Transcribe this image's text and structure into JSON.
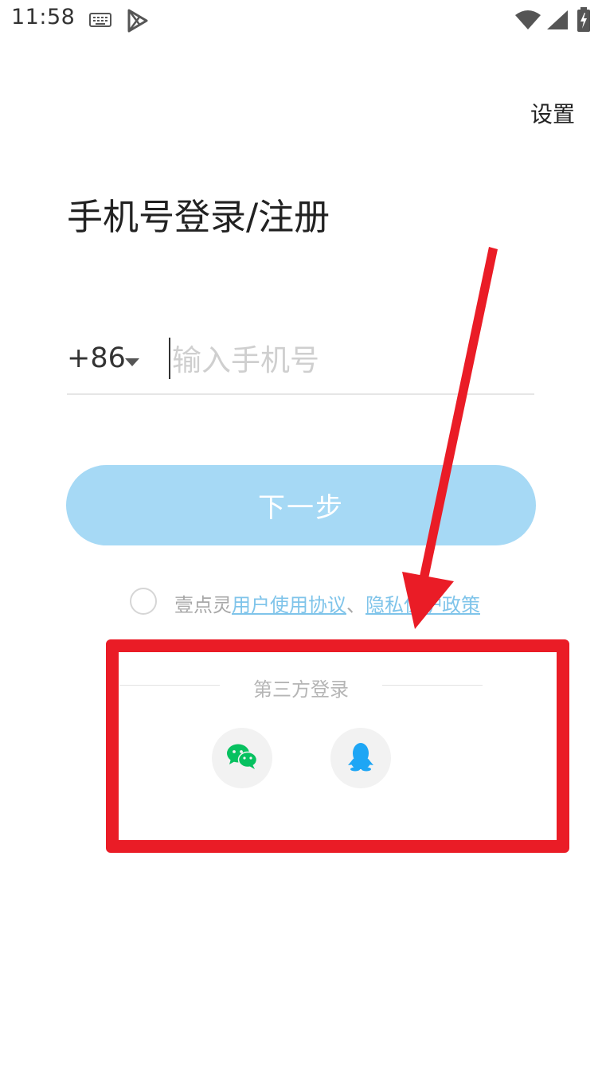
{
  "status_bar": {
    "time": "11:58",
    "icons": [
      "keyboard-icon",
      "play-store-icon",
      "wifi-icon",
      "signal-icon",
      "battery-charging-icon"
    ]
  },
  "header": {
    "settings_label": "设置"
  },
  "main": {
    "title": "手机号登录/注册",
    "country_code": "+86",
    "phone_input": {
      "placeholder": "输入手机号",
      "value": ""
    },
    "next_button_label": "下一步",
    "agreement": {
      "checked": false,
      "prefix": "壹点灵",
      "user_agreement_link": "用户使用协议",
      "separator": "、",
      "privacy_link": "隐私保护政策"
    }
  },
  "third_party": {
    "title": "第三方登录",
    "providers": [
      {
        "name": "WeChat",
        "icon": "wechat-icon",
        "color": "#07c160"
      },
      {
        "name": "QQ",
        "icon": "qq-icon",
        "color": "#1ea6f5"
      }
    ]
  },
  "annotation": {
    "color": "#ea1c26"
  }
}
